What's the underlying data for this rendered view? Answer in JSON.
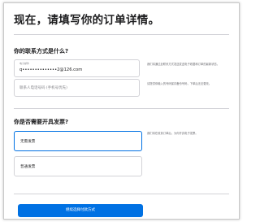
{
  "page_title": "现在，请填写你的订单详情。",
  "contact": {
    "heading": "你的联系方式是什么?",
    "email_field": {
      "label": "电子邮件",
      "value": "q••••••••••••••2@126.com"
    },
    "phone_field": {
      "placeholder": "联系人电话号码 (手机号优先)"
    },
    "email_note": "我们将通过此联系方式发送发送电子收据和订单的最新状态。",
    "phone_note": "请提供你输入的号码保存备份号码，下单后无法更改。"
  },
  "invoice": {
    "heading": "你是否需要开具发票?",
    "options": [
      {
        "label": "无需发票",
        "selected": true
      },
      {
        "label": "普通发票",
        "selected": false
      }
    ],
    "note": "我们将在收到订单后，为你开具电子发票。"
  },
  "cta_label": "继续选择付款方式",
  "colors": {
    "accent": "#0071e3",
    "text": "#1d1d1f",
    "muted": "#86868b",
    "border": "#d2d2d7"
  }
}
